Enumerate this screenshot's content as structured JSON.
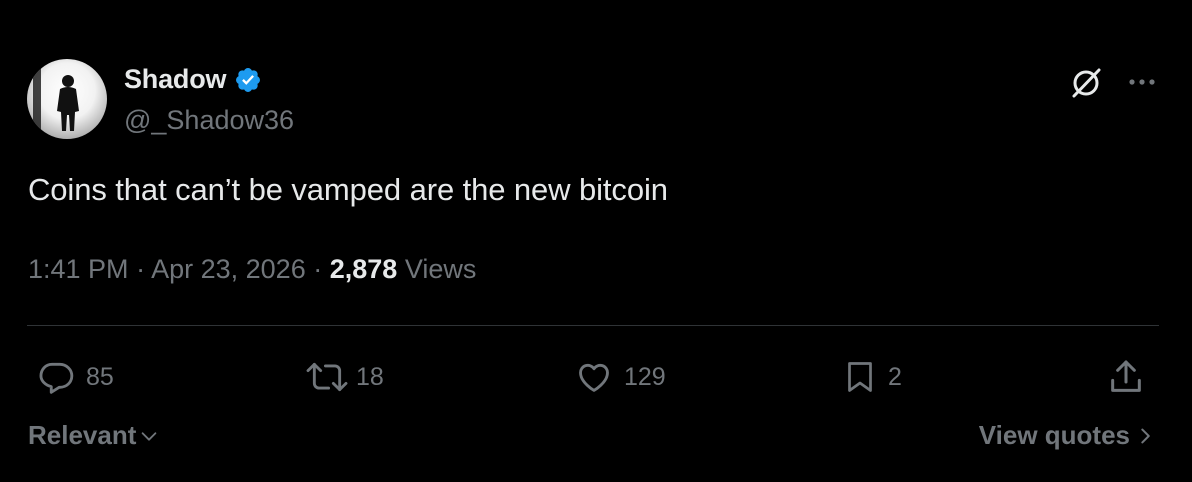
{
  "author": {
    "display_name": "Shadow",
    "handle": "@_Shadow36",
    "verified": true,
    "verified_color": "#1d9bf0"
  },
  "tweet": {
    "text": "Coins that can’t be vamped are the new bitcoin",
    "time": "1:41 PM",
    "separator": "·",
    "date": "Apr 23, 2026",
    "views_count": "2,878",
    "views_label": "Views"
  },
  "header_icons": [
    "grok-icon",
    "more-icon"
  ],
  "actions": {
    "replies": "85",
    "reposts": "18",
    "likes": "129",
    "bookmarks": "2"
  },
  "footer": {
    "sort_label": "Relevant",
    "quotes_label": "View quotes"
  },
  "colors": {
    "background": "#000000",
    "primary_text": "#e7e9ea",
    "secondary_text": "#71767b",
    "divider": "#2f3336"
  }
}
